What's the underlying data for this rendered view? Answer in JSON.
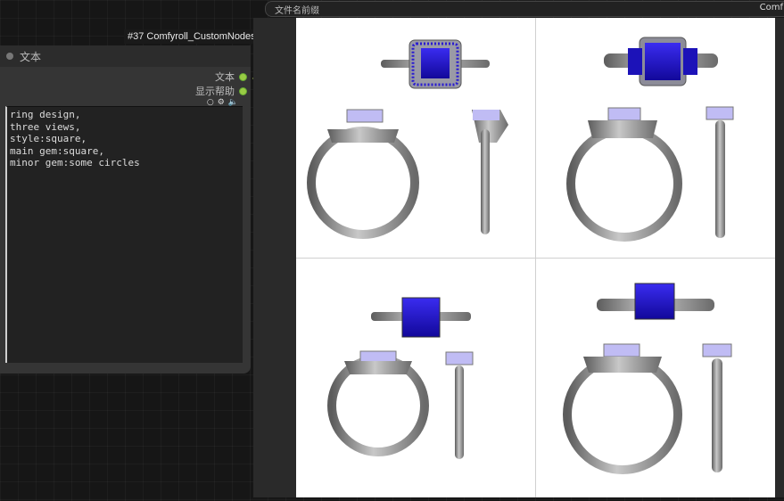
{
  "node": {
    "badge": "#37 Comfyroll_CustomNodes",
    "title": "文本",
    "outputs": [
      {
        "label": "文本"
      },
      {
        "label": "显示帮助"
      }
    ],
    "text_value": "ring design,\nthree views,\nstyle:square,\nmain gem:square,\nminor gem:some circles",
    "control_icons": [
      "circle-icon",
      "gear-icon",
      "speaker-icon"
    ]
  },
  "preview": {
    "filename_label": "文件名前缀",
    "filename_value": "Comf"
  },
  "colors": {
    "gem_blue": "#1f14d6",
    "metal": "#8a8a8a",
    "port_green": "#99cc44"
  }
}
